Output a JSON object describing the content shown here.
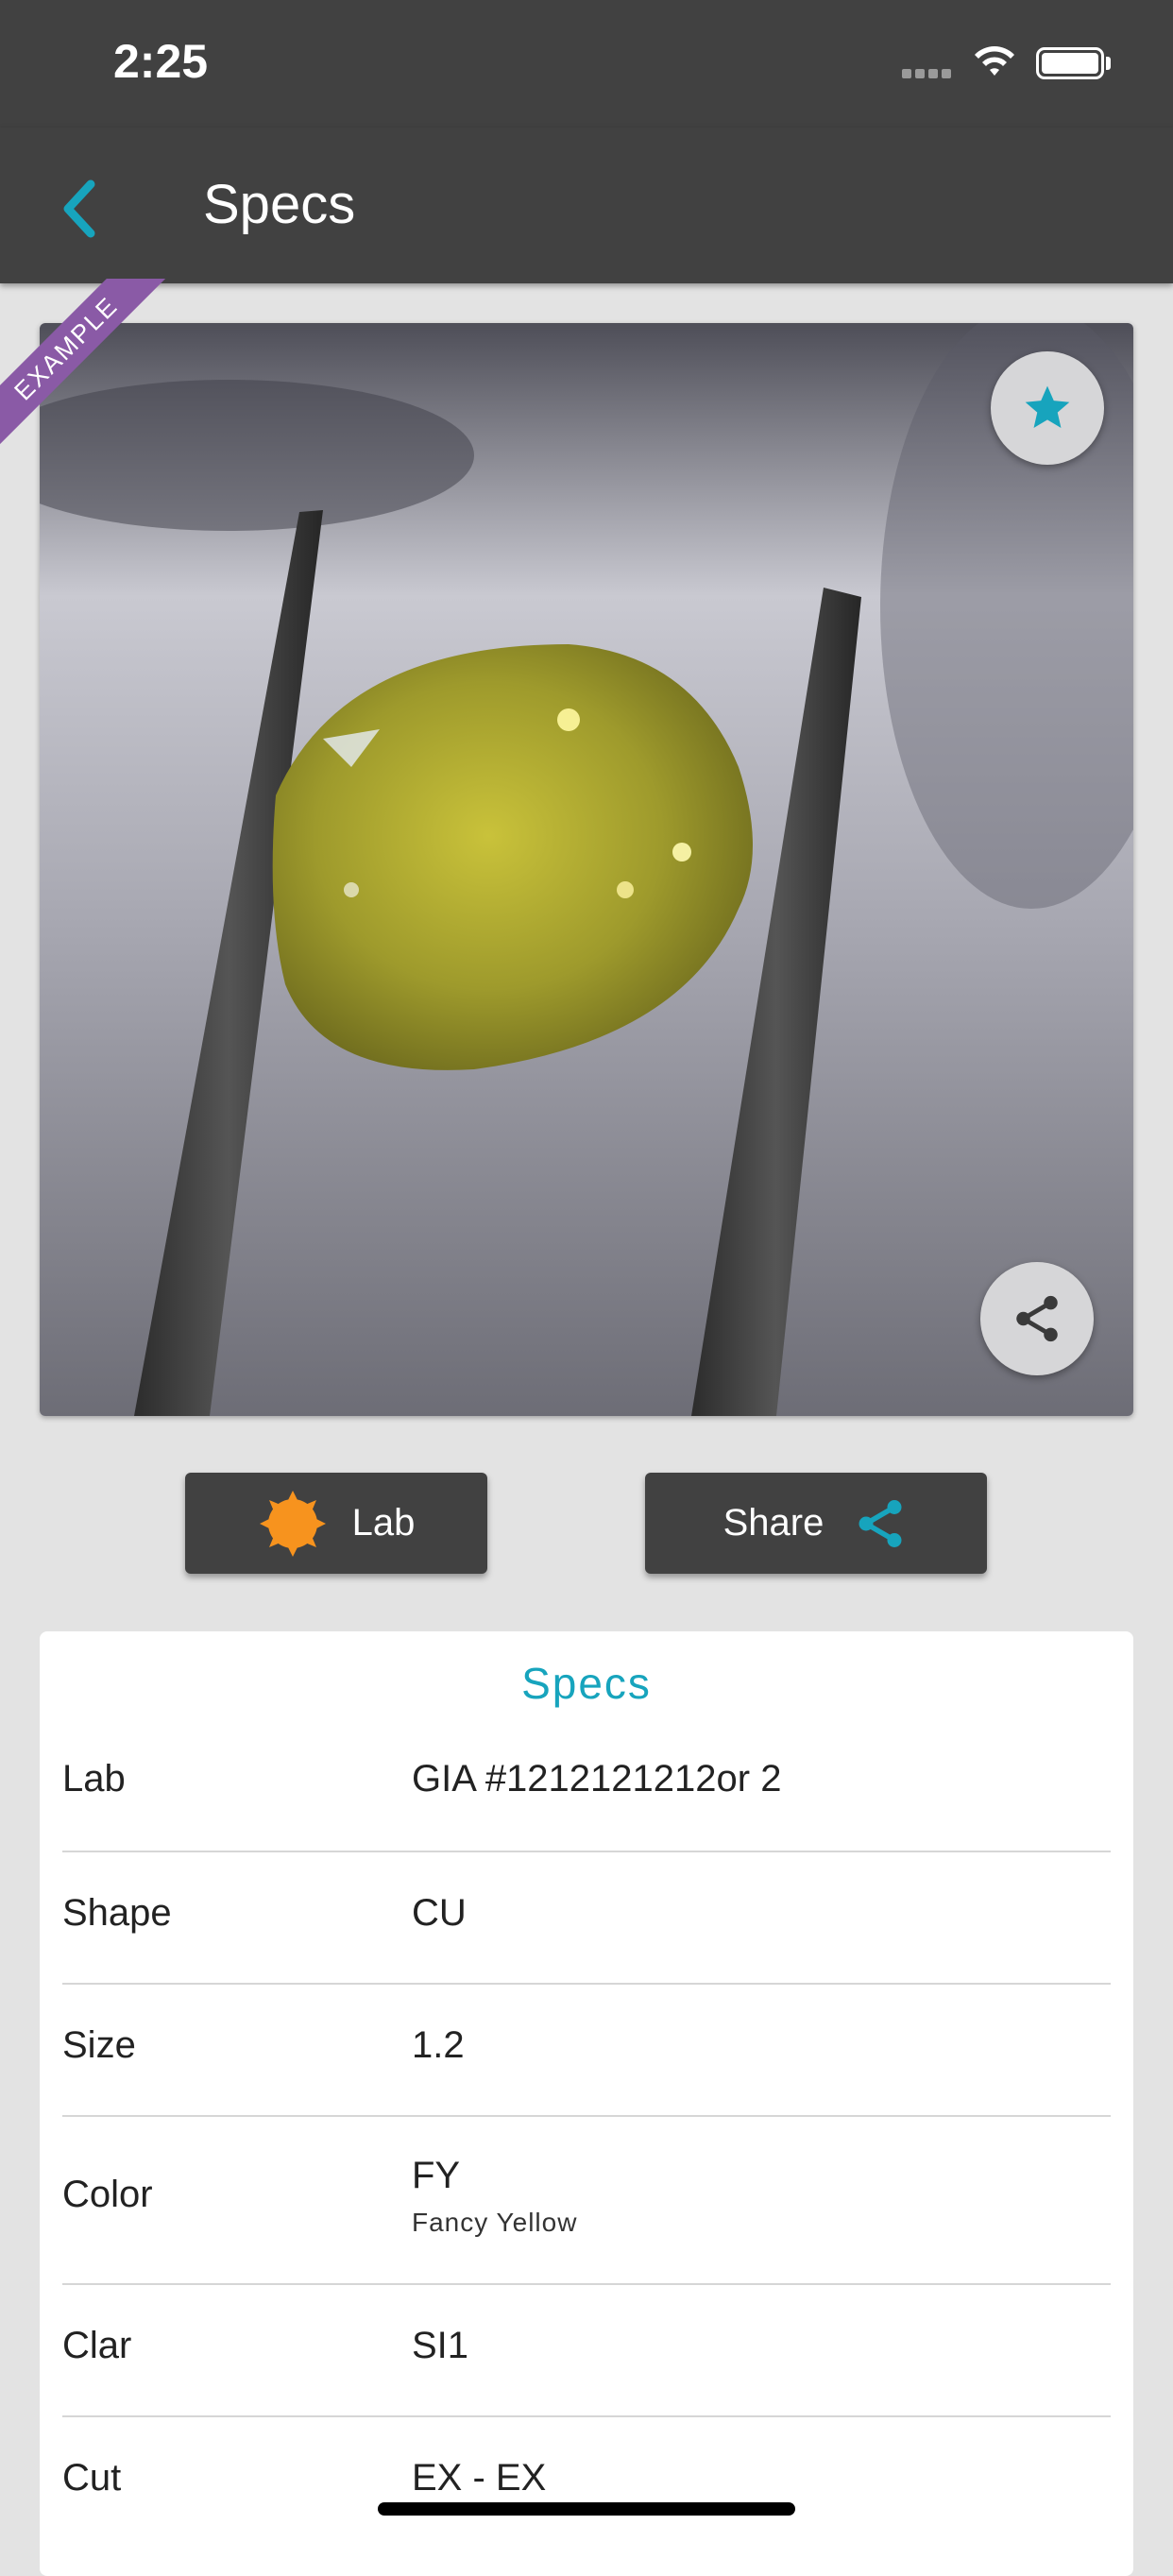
{
  "status_bar": {
    "time": "2:25"
  },
  "app_bar": {
    "title": "Specs"
  },
  "photo": {
    "ribbon": "EXAMPLE",
    "accent": "#17a4bd"
  },
  "actions": {
    "lab_label": "Lab",
    "share_label": "Share"
  },
  "specs": {
    "title": "Specs",
    "rows": [
      {
        "label": "Lab",
        "value": "GIA #1212121212or 2"
      },
      {
        "label": "Shape",
        "value": "CU"
      },
      {
        "label": "Size",
        "value": "1.2"
      },
      {
        "label": "Color",
        "value": "FY",
        "sub": "Fancy Yellow"
      },
      {
        "label": "Clar",
        "value": "SI1"
      },
      {
        "label": "Cut",
        "value": "EX - EX"
      }
    ]
  }
}
